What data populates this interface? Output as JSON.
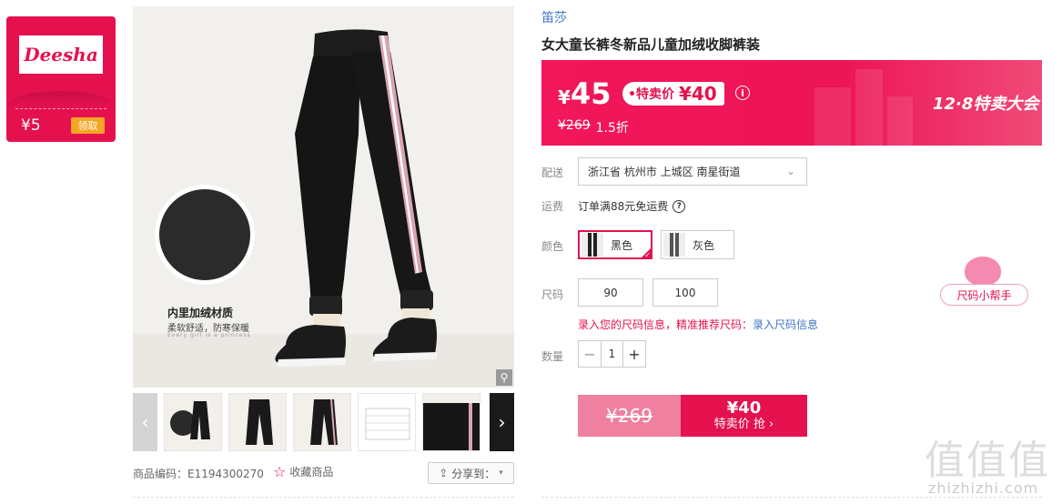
{
  "brand_card": {
    "logo": "Deesha",
    "coupon_amount": "¥5",
    "claim_label": "领取"
  },
  "gallery": {
    "inset_title": "内里加绒材质",
    "inset_subtitle": "柔软舒适，防寒保暖",
    "inset_tagline": "Every girl is a princess",
    "thumb_count": 6
  },
  "footer": {
    "sku": "商品编码：E1194300270",
    "favorite_label": "收藏商品",
    "share_label": "分享到："
  },
  "product": {
    "brand": "笛莎",
    "title": "女大童长裤冬新品儿童加绒收脚裤装"
  },
  "price": {
    "yen_symbol": "¥",
    "current": "45",
    "promo_label": "•特卖价",
    "promo_price": "¥40",
    "original": "¥269",
    "discount": "1.5折",
    "event": "12·8特卖大会"
  },
  "shipping": {
    "label": "配送",
    "location": "浙江省 杭州市 上城区 南星街道"
  },
  "freight": {
    "label": "运费",
    "text": "订单满88元免运费"
  },
  "colors": {
    "label": "颜色",
    "options": [
      {
        "name": "黑色",
        "selected": true
      },
      {
        "name": "灰色",
        "selected": false
      }
    ]
  },
  "sizes": {
    "label": "尺码",
    "options": [
      "90",
      "100"
    ],
    "hint": "录入您的尺码信息，精准推荐尺码：",
    "hint_link": "录入尺码信息"
  },
  "quantity": {
    "label": "数量",
    "value": "1",
    "minus": "−",
    "plus": "+"
  },
  "buy": {
    "original": "¥269",
    "price": "¥40",
    "label": "特卖价 抢 ›"
  },
  "helper": {
    "label": "尺码小帮手"
  },
  "watermark": {
    "chars": "值值值",
    "url": "zhizhizhi.com"
  },
  "colors_theme": {
    "accent": "#e5114f",
    "link": "#3d73c9"
  }
}
